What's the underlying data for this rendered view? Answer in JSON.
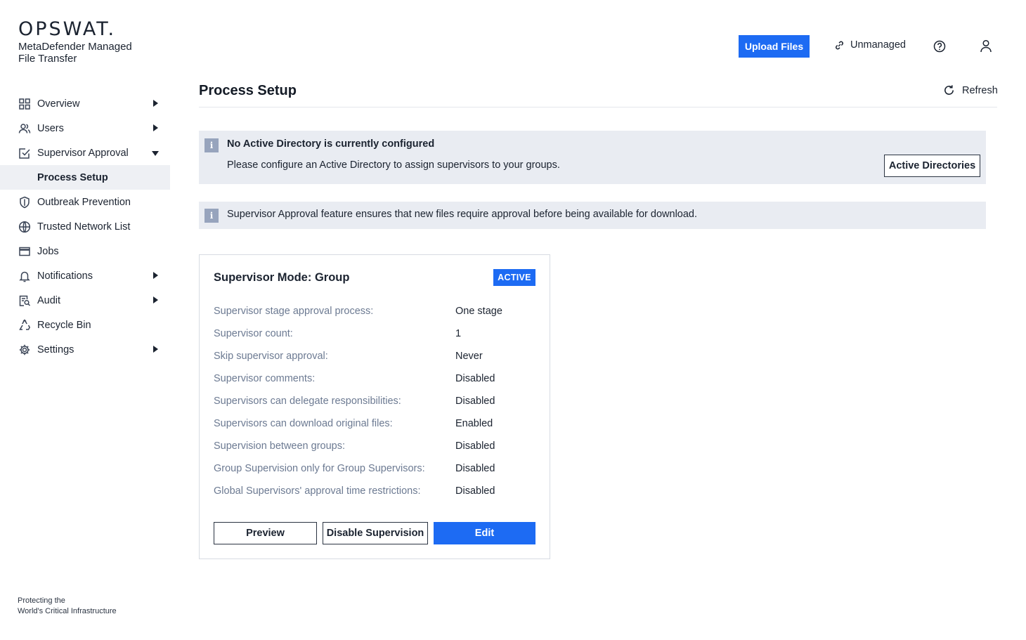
{
  "brand": {
    "logo": "OPSWAT.",
    "product": "MetaDefender Managed File Transfer",
    "footer_line1": "Protecting the",
    "footer_line2": "World's Critical Infrastructure"
  },
  "header": {
    "upload_label": "Upload Files",
    "unmanaged_label": "Unmanaged",
    "help_icon": "help-icon",
    "user_icon": "user-icon"
  },
  "sidebar": {
    "items": [
      {
        "label": "Overview",
        "icon": "grid-icon",
        "expandable": true
      },
      {
        "label": "Users",
        "icon": "users-icon",
        "expandable": true
      },
      {
        "label": "Supervisor Approval",
        "icon": "approval-icon",
        "expanded": true
      },
      {
        "label": "Process Setup",
        "active": true
      },
      {
        "label": "Outbreak Prevention",
        "icon": "shield-icon"
      },
      {
        "label": "Trusted Network List",
        "icon": "globe-icon"
      },
      {
        "label": "Jobs",
        "icon": "window-icon"
      },
      {
        "label": "Notifications",
        "icon": "bell-icon",
        "expandable": true
      },
      {
        "label": "Audit",
        "icon": "audit-icon",
        "expandable": true
      },
      {
        "label": "Recycle Bin",
        "icon": "recycle-icon"
      },
      {
        "label": "Settings",
        "icon": "gear-icon",
        "expandable": true
      }
    ]
  },
  "main": {
    "title": "Process Setup",
    "refresh_label": "Refresh",
    "alert1": {
      "title": "No Active Directory is currently configured",
      "text": "Please configure an Active Directory to assign supervisors to your groups.",
      "button": "Active Directories"
    },
    "alert2": {
      "text": "Supervisor Approval feature ensures that new files require approval before being available for download."
    },
    "info_glyph": "i",
    "card": {
      "title": "Supervisor Mode: Group",
      "status": "ACTIVE",
      "rows": [
        {
          "label": "Supervisor stage approval process:",
          "value": "One stage"
        },
        {
          "label": "Supervisor count:",
          "value": "1"
        },
        {
          "label": "Skip supervisor approval:",
          "value": "Never"
        },
        {
          "label": "Supervisor comments:",
          "value": "Disabled"
        },
        {
          "label": "Supervisors can delegate responsibilities:",
          "value": "Disabled"
        },
        {
          "label": "Supervisors can download original files:",
          "value": "Enabled"
        },
        {
          "label": "Supervision between groups:",
          "value": "Disabled"
        },
        {
          "label": "Group Supervision only for Group Supervisors:",
          "value": "Disabled"
        },
        {
          "label": "Global Supervisors' approval time restrictions:",
          "value": "Disabled"
        }
      ],
      "preview_label": "Preview",
      "disable_label": "Disable Supervision",
      "edit_label": "Edit"
    }
  },
  "colors": {
    "accent": "#1d6bf3",
    "alert_bg": "#e9ecf2",
    "label_gray": "#6c7a92"
  }
}
